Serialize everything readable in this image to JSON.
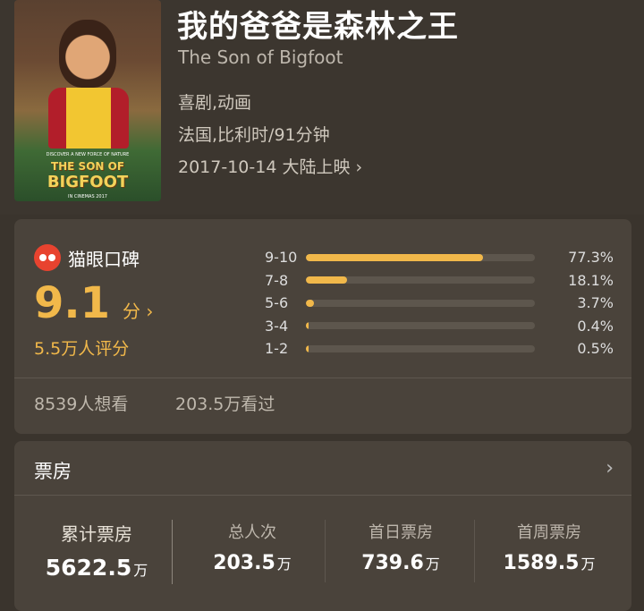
{
  "movie": {
    "title": "我的爸爸是森林之王",
    "original_title": "The Son of Bigfoot",
    "genres": "喜剧,动画",
    "region_runtime": "法国,比利时/91分钟",
    "release": "2017-10-14 大陆上映",
    "release_chevron": "›",
    "poster": {
      "tagline": "DISCOVER A NEW FORCE OF NATURE",
      "title_line1": "THE SON OF",
      "title_line2": "BIGFOOT",
      "footer": "IN CINEMAS 2017"
    }
  },
  "rating": {
    "brand_icon": "maoyan-cat-icon",
    "brand_label": "猫眼口碑",
    "score": "9.1",
    "score_unit": "分 ›",
    "rating_count": "5.5万人评分",
    "distribution": [
      {
        "label": "9-10",
        "percent": 77.3,
        "percent_text": "77.3%"
      },
      {
        "label": "7-8",
        "percent": 18.1,
        "percent_text": "18.1%"
      },
      {
        "label": "5-6",
        "percent": 3.7,
        "percent_text": "3.7%"
      },
      {
        "label": "3-4",
        "percent": 0.4,
        "percent_text": "0.4%"
      },
      {
        "label": "1-2",
        "percent": 0.5,
        "percent_text": "0.5%"
      }
    ],
    "want_to_see": "8539人想看",
    "watched": "203.5万看过"
  },
  "box_office": {
    "title": "票房",
    "chevron": "›",
    "stats": [
      {
        "label": "累计票房",
        "value": "5622.5",
        "unit": "万"
      },
      {
        "label": "总人次",
        "value": "203.5",
        "unit": "万"
      },
      {
        "label": "首日票房",
        "value": "739.6",
        "unit": "万"
      },
      {
        "label": "首周票房",
        "value": "1589.5",
        "unit": "万"
      }
    ]
  },
  "colors": {
    "background": "#3a342d",
    "card": "#4a433b",
    "accent": "#f1b84a",
    "brand_red": "#e8432f"
  }
}
